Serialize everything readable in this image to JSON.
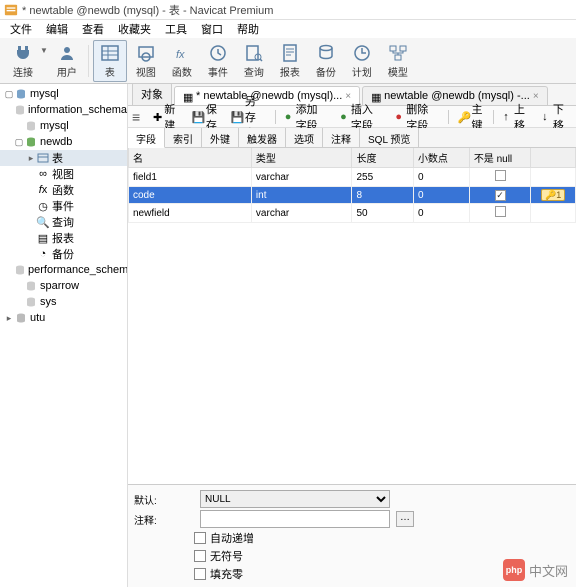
{
  "window": {
    "title": "* newtable @newdb (mysql) - 表 - Navicat Premium"
  },
  "menu": {
    "items": [
      "文件",
      "编辑",
      "查看",
      "收藏夹",
      "工具",
      "窗口",
      "帮助"
    ]
  },
  "toolbar": {
    "connect": "连接",
    "user": "用户",
    "table": "表",
    "view": "视图",
    "func": "函数",
    "event": "事件",
    "query": "查询",
    "report": "报表",
    "backup": "备份",
    "plan": "计划",
    "model": "模型"
  },
  "tree": {
    "root": "mysql",
    "dbs": {
      "info": "information_schema",
      "mysql2": "mysql",
      "newdb": "newdb",
      "perf": "performance_schema",
      "sparrow": "sparrow",
      "sys": "sys",
      "utu": "utu"
    },
    "children": {
      "table": "表",
      "view": "视图",
      "func": "函数",
      "event": "事件",
      "query": "查询",
      "report": "报表",
      "backup": "备份"
    }
  },
  "tabs": {
    "objects": "对象",
    "t1": "* newtable @newdb (mysql)...",
    "t2": "newtable @newdb (mysql) -..."
  },
  "actions": {
    "new": "新建",
    "save": "保存",
    "saveas": "另存为",
    "addfield": "添加字段",
    "insertfield": "插入字段",
    "delfield": "删除字段",
    "primarykey": "主键",
    "up": "上移",
    "down": "下移"
  },
  "subtabs": [
    "字段",
    "索引",
    "外键",
    "触发器",
    "选项",
    "注释",
    "SQL 预览"
  ],
  "columns": {
    "name": "名",
    "type": "类型",
    "length": "长度",
    "decimals": "小数点",
    "notnull": "不是 null",
    "key": ""
  },
  "rows": [
    {
      "name": "field1",
      "type": "varchar",
      "length": "255",
      "decimals": "0",
      "notnull": false,
      "key": false,
      "selected": false
    },
    {
      "name": "code",
      "type": "int",
      "length": "8",
      "decimals": "0",
      "notnull": true,
      "key": true,
      "selected": true
    },
    {
      "name": "newfield",
      "type": "varchar",
      "length": "50",
      "decimals": "0",
      "notnull": false,
      "key": false,
      "selected": false
    }
  ],
  "bottom": {
    "default_lbl": "默认:",
    "default_val": "NULL",
    "comment_lbl": "注释:",
    "auto": "自动递增",
    "unsigned": "无符号",
    "zerofill": "填充零"
  },
  "watermark": {
    "badge": "php",
    "text": "中文网"
  }
}
